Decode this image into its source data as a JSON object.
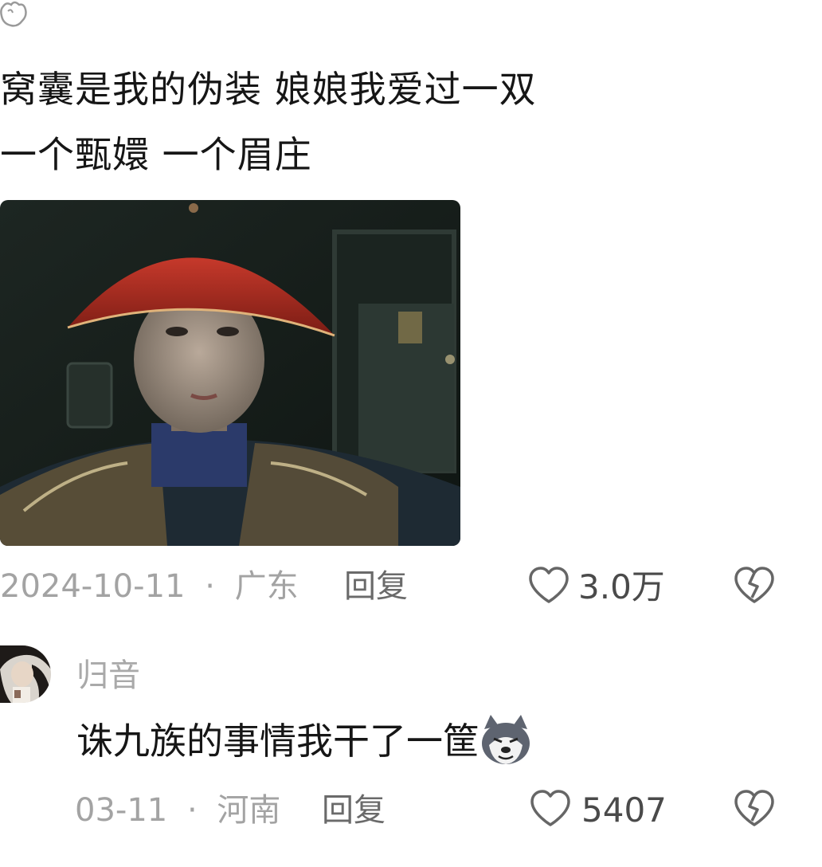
{
  "comment": {
    "lines": [
      "窝囊是我的伪装 娘娘我爱过一双",
      "一个甄嬛 一个眉庄"
    ],
    "meta": {
      "date": "2024-10-11",
      "separator": "·",
      "location": "广东"
    },
    "reply_label": "回复",
    "like_count": "3.0万",
    "icons": {
      "top": "paw-emoji-icon",
      "like": "heart-outline-icon",
      "dislike": "broken-heart-icon"
    }
  },
  "reply_comment": {
    "username": "归音",
    "text": "诛九族的事情我干了一筐",
    "emoji": "wolf-emoji-icon",
    "meta": {
      "date": "03-11",
      "separator": "·",
      "location": "河南"
    },
    "reply_label": "回复",
    "like_count": "5407"
  },
  "colors": {
    "text": "#161616",
    "meta": "#a3a3a3",
    "reply": "#6a6a6a",
    "icon": "#666666"
  }
}
